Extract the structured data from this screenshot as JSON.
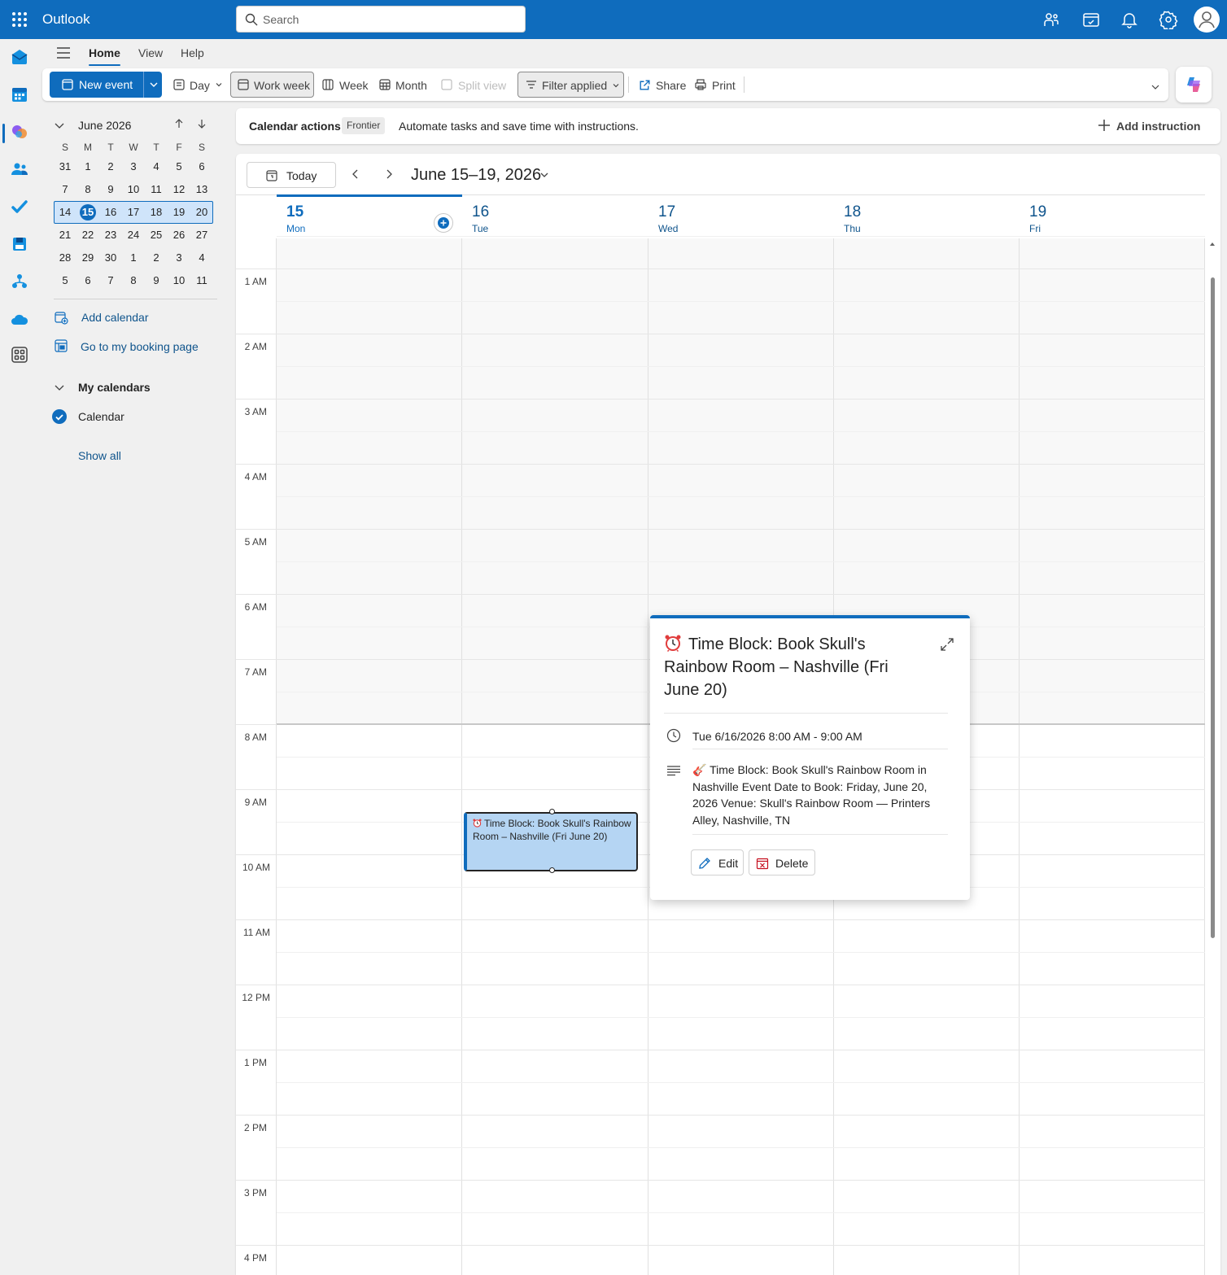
{
  "app": {
    "name": "Outlook"
  },
  "search": {
    "placeholder": "Search"
  },
  "tabs": [
    "Home",
    "View",
    "Help"
  ],
  "ribbon": {
    "new_event": "New event",
    "day": "Day",
    "work_week": "Work week",
    "week": "Week",
    "month": "Month",
    "split_view": "Split view",
    "filter": "Filter applied",
    "share": "Share",
    "print": "Print"
  },
  "mini_calendar": {
    "title": "June 2026",
    "weekday_headers": [
      "S",
      "M",
      "T",
      "W",
      "T",
      "F",
      "S"
    ],
    "weeks": [
      [
        "31",
        "1",
        "2",
        "3",
        "4",
        "5",
        "6"
      ],
      [
        "7",
        "8",
        "9",
        "10",
        "11",
        "12",
        "13"
      ],
      [
        "14",
        "15",
        "16",
        "17",
        "18",
        "19",
        "20"
      ],
      [
        "21",
        "22",
        "23",
        "24",
        "25",
        "26",
        "27"
      ],
      [
        "28",
        "29",
        "30",
        "1",
        "2",
        "3",
        "4"
      ],
      [
        "5",
        "6",
        "7",
        "8",
        "9",
        "10",
        "11"
      ]
    ],
    "today": "15"
  },
  "left_pane": {
    "add_calendar": "Add calendar",
    "booking": "Go to my booking page",
    "my_calendars": "My calendars",
    "calendar_name": "Calendar",
    "show_all": "Show all"
  },
  "calendar_actions": {
    "title": "Calendar actions",
    "badge": "Frontier",
    "description": "Automate tasks and save time with instructions.",
    "add": "Add instruction"
  },
  "nav": {
    "today": "Today",
    "range": "June 15–19, 2026"
  },
  "days": [
    {
      "num": "15",
      "name": "Mon"
    },
    {
      "num": "16",
      "name": "Tue"
    },
    {
      "num": "17",
      "name": "Wed"
    },
    {
      "num": "18",
      "name": "Thu"
    },
    {
      "num": "19",
      "name": "Fri"
    }
  ],
  "hours": [
    "1 AM",
    "2 AM",
    "3 AM",
    "4 AM",
    "5 AM",
    "6 AM",
    "7 AM",
    "8 AM",
    "9 AM",
    "10 AM",
    "11 AM",
    "12 PM",
    "1 PM",
    "2 PM",
    "3 PM",
    "4 PM"
  ],
  "event": {
    "title": "Time Block: Book Skull's Rainbow Room – Nashville (Fri June 20)"
  },
  "popup": {
    "title": "Time Block: Book Skull's Rainbow Room – Nashville (Fri June 20)",
    "time": "Tue 6/16/2026 8:00 AM - 9:00 AM",
    "description": "🎸 Time Block: Book Skull's Rainbow Room in Nashville Event Date to Book: Friday, June 20, 2026 Venue: Skull's Rainbow Room — Printers Alley, Nashville, TN",
    "edit": "Edit",
    "delete": "Delete"
  },
  "colors": {
    "brand": "#0f6cbd",
    "event_fill": "#b5d5f3"
  }
}
